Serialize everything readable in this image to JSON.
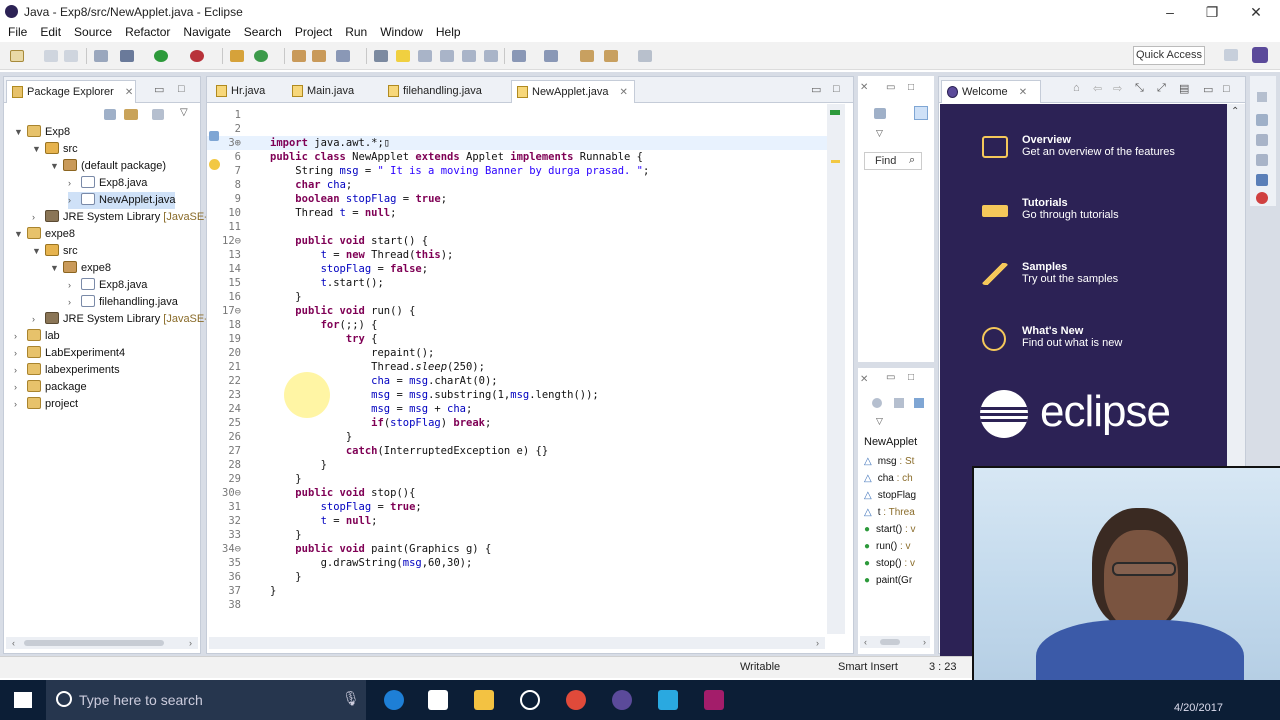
{
  "window": {
    "title": "Java - Exp8/src/NewApplet.java - Eclipse"
  },
  "menubar": [
    "File",
    "Edit",
    "Source",
    "Refactor",
    "Navigate",
    "Search",
    "Project",
    "Run",
    "Window",
    "Help"
  ],
  "toolbar": {
    "quick_access": "Quick Access"
  },
  "package_explorer": {
    "tab_label": "Package Explorer",
    "tree": [
      {
        "label": "Exp8",
        "type": "proj",
        "depth": 0,
        "twisty": "▼"
      },
      {
        "label": "src",
        "type": "src",
        "depth": 1,
        "twisty": "▼"
      },
      {
        "label": "(default package)",
        "type": "pkg",
        "depth": 2,
        "twisty": "▼"
      },
      {
        "label": "Exp8.java",
        "type": "java",
        "depth": 3,
        "twisty": "›"
      },
      {
        "label": "NewApplet.java",
        "type": "java",
        "depth": 3,
        "twisty": "›",
        "selected": true
      },
      {
        "label": "JRE System Library",
        "suffix": "[JavaSE-",
        "type": "lib",
        "depth": 1,
        "twisty": "›"
      },
      {
        "label": "expe8",
        "type": "proj",
        "depth": 0,
        "twisty": "▼"
      },
      {
        "label": "src",
        "type": "src",
        "depth": 1,
        "twisty": "▼"
      },
      {
        "label": "expe8",
        "type": "pkg",
        "depth": 2,
        "twisty": "▼"
      },
      {
        "label": "Exp8.java",
        "type": "java",
        "depth": 3,
        "twisty": "›"
      },
      {
        "label": "filehandling.java",
        "type": "java",
        "depth": 3,
        "twisty": "›"
      },
      {
        "label": "JRE System Library",
        "suffix": "[JavaSE-",
        "type": "lib",
        "depth": 1,
        "twisty": "›"
      },
      {
        "label": "lab",
        "type": "proj",
        "depth": 0,
        "twisty": "›"
      },
      {
        "label": "LabExperiment4",
        "type": "proj",
        "depth": 0,
        "twisty": "›"
      },
      {
        "label": "labexperiments",
        "type": "proj",
        "depth": 0,
        "twisty": "›"
      },
      {
        "label": "package",
        "type": "proj",
        "depth": 0,
        "twisty": "›"
      },
      {
        "label": "project",
        "type": "proj",
        "depth": 0,
        "twisty": "›"
      }
    ]
  },
  "editor": {
    "tabs": [
      "Hr.java",
      "Main.java",
      "filehandling.java",
      "NewApplet.java"
    ],
    "active_tab": 3,
    "lines": [
      {
        "n": "1",
        "html": ""
      },
      {
        "n": "2",
        "html": ""
      },
      {
        "n": "3⊕",
        "html": "<span class='kw'>import</span> java.awt.*;▯",
        "current": true
      },
      {
        "n": "6",
        "html": "<span class='kw'>public class</span> NewApplet <span class='kw'>extends</span> Applet <span class='kw'>implements</span> Runnable {"
      },
      {
        "n": "7",
        "html": "    String <span class='fld'>msg</span> = <span class='str'>\" It is a moving Banner by durga prasad. \"</span>;"
      },
      {
        "n": "8",
        "html": "    <span class='kw'>char</span> <span class='fld'>cha</span>;"
      },
      {
        "n": "9",
        "html": "    <span class='kw'>boolean</span> <span class='fld'>stopFlag</span> = <span class='kw'>true</span>;"
      },
      {
        "n": "10",
        "html": "    Thread <span class='fld'>t</span> = <span class='kw'>null</span>;"
      },
      {
        "n": "11",
        "html": ""
      },
      {
        "n": "12⊖",
        "html": "    <span class='kw'>public void</span> start() {"
      },
      {
        "n": "13",
        "html": "        <span class='fld'>t</span> = <span class='kw'>new</span> Thread(<span class='kw'>this</span>);"
      },
      {
        "n": "14",
        "html": "        <span class='fld'>stopFlag</span> = <span class='kw'>false</span>;"
      },
      {
        "n": "15",
        "html": "        <span class='fld'>t</span>.start();"
      },
      {
        "n": "16",
        "html": "    }"
      },
      {
        "n": "17⊖",
        "html": "    <span class='kw'>public void</span> run() {"
      },
      {
        "n": "18",
        "html": "        <span class='kw'>for</span>(;;) {"
      },
      {
        "n": "19",
        "html": "            <span class='kw'>try</span> {"
      },
      {
        "n": "20",
        "html": "                repaint();"
      },
      {
        "n": "21",
        "html": "                Thread.<span class='ital'>sleep</span>(250);"
      },
      {
        "n": "22",
        "html": "                <span class='fld'>cha</span> = <span class='fld'>msg</span>.charAt(0);"
      },
      {
        "n": "23",
        "html": "                <span class='fld'>msg</span> = <span class='fld'>msg</span>.substring(1,<span class='fld'>msg</span>.length());"
      },
      {
        "n": "24",
        "html": "                <span class='fld'>msg</span> = <span class='fld'>msg</span> + <span class='fld'>cha</span>;"
      },
      {
        "n": "25",
        "html": "                <span class='kw'>if</span>(<span class='fld'>stopFlag</span>) <span class='kw'>break</span>;"
      },
      {
        "n": "26",
        "html": "            }"
      },
      {
        "n": "27",
        "html": "            <span class='kw'>catch</span>(InterruptedException e) {}"
      },
      {
        "n": "28",
        "html": "        }"
      },
      {
        "n": "29",
        "html": "    }"
      },
      {
        "n": "30⊖",
        "html": "    <span class='kw'>public void</span> stop(){"
      },
      {
        "n": "31",
        "html": "        <span class='fld'>stopFlag</span> = <span class='kw'>true</span>;"
      },
      {
        "n": "32",
        "html": "        <span class='fld'>t</span> = <span class='kw'>null</span>;"
      },
      {
        "n": "33",
        "html": "    }"
      },
      {
        "n": "34⊖",
        "html": "    <span class='kw'>public void</span> paint(Graphics g) {"
      },
      {
        "n": "35",
        "html": "        g.drawString(<span class='fld'>msg</span>,60,30);"
      },
      {
        "n": "36",
        "html": "    }"
      },
      {
        "n": "37",
        "html": "}"
      },
      {
        "n": "38",
        "html": ""
      }
    ]
  },
  "find_panel": {
    "find_label": "Find"
  },
  "outline": {
    "title": "NewApplet",
    "items": [
      {
        "sym": "△",
        "name": "msg",
        "type": ": St"
      },
      {
        "sym": "△",
        "name": "cha",
        "type": ": ch"
      },
      {
        "sym": "△",
        "name": "stopFlag",
        "type": ""
      },
      {
        "sym": "△",
        "name": "t",
        "type": ": Threa"
      },
      {
        "sym": "●",
        "name": "start()",
        "type": ": v"
      },
      {
        "sym": "●",
        "name": "run()",
        "type": ": v"
      },
      {
        "sym": "●",
        "name": "stop()",
        "type": ": v"
      },
      {
        "sym": "●",
        "name": "paint(Gr",
        "type": ""
      }
    ]
  },
  "welcome": {
    "tab_label": "Welcome",
    "items": [
      {
        "title": "Overview",
        "sub": "Get an overview of the features"
      },
      {
        "title": "Tutorials",
        "sub": "Go through tutorials"
      },
      {
        "title": "Samples",
        "sub": "Try out the samples"
      },
      {
        "title": "What's New",
        "sub": "Find out what is new"
      }
    ],
    "logo_text": "eclipse"
  },
  "statusbar": {
    "writable": "Writable",
    "insert_mode": "Smart Insert",
    "position": "3 : 23"
  },
  "taskbar": {
    "search_placeholder": "Type here to search",
    "date": "4/20/2017"
  },
  "colors": {
    "welcome_bg": "#2c2255",
    "accent": "#f5c85a",
    "taskbar_bg": "#0c1e36"
  }
}
